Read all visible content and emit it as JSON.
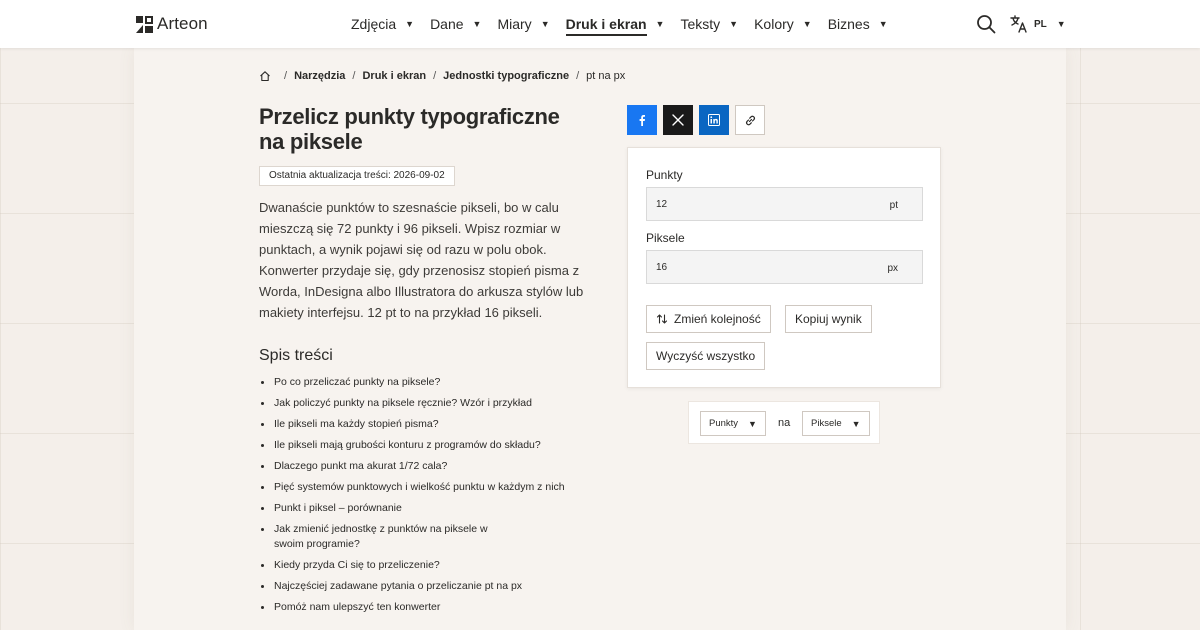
{
  "header": {
    "brand": "Arteon",
    "nav": [
      {
        "label": "Zdjęcia",
        "active": false
      },
      {
        "label": "Dane",
        "active": false
      },
      {
        "label": "Miary",
        "active": false
      },
      {
        "label": "Druk i ekran",
        "active": true
      },
      {
        "label": "Teksty",
        "active": false
      },
      {
        "label": "Kolory",
        "active": false
      },
      {
        "label": "Biznes",
        "active": false
      }
    ],
    "language": "PL"
  },
  "breadcrumb": {
    "items": [
      "Narzędzia",
      "Druk i ekran",
      "Jednostki typograficzne"
    ],
    "current": "pt na px"
  },
  "page": {
    "title": "Przelicz punkty typograficzne na piksele",
    "updated": "Ostatnia aktualizacja treści: 2026-09-02",
    "intro": "Dwanaście punktów to szesnaście pikseli, bo w calu mieszczą się 72 punkty i 96 pikseli. Wpisz rozmiar w punktach, a wynik pojawi się od razu w polu obok. Konwerter przydaje się, gdy przenosisz stopień pisma z Worda, InDesigna albo Illustratora do arkusza stylów lub makiety interfejsu. 12 pt to na przykład 16 pikseli."
  },
  "toc": {
    "title": "Spis treści",
    "items": [
      "Po co przeliczać punkty na piksele?",
      "Jak policzyć punkty na piksele ręcznie? Wzór i przykład",
      "Ile pikseli ma każdy stopień pisma?",
      "Ile pikseli mają grubości konturu z programów do składu?",
      "Dlaczego punkt ma akurat 1/72 cala?",
      "Pięć systemów punktowych i wielkość punktu w każdym z nich",
      "Punkt i piksel – porównanie",
      "Jak zmienić jednostkę z punktów na piksele w swoim programie?",
      "Kiedy przyda Ci się to przeliczenie?",
      "Najczęściej zadawane pytania o przeliczanie pt na px",
      "Pomóż nam ulepszyć ten konwerter"
    ]
  },
  "converter": {
    "input_label": "Punkty",
    "input_value": "12",
    "input_unit": "pt",
    "output_label": "Piksele",
    "output_value": "16",
    "output_unit": "px",
    "swap_label": "Zmień kolejność",
    "copy_label": "Kopiuj wynik",
    "clear_label": "Wyczyść wszystko"
  },
  "unit_selector": {
    "from": "Punkty",
    "connector": "na",
    "to": "Piksele"
  },
  "colors": {
    "facebook": "#1877f2",
    "x": "#1a1a1a",
    "linkedin": "#0a66c2",
    "page_bg": "#f4efea",
    "card_bg": "#f7f3ef"
  }
}
